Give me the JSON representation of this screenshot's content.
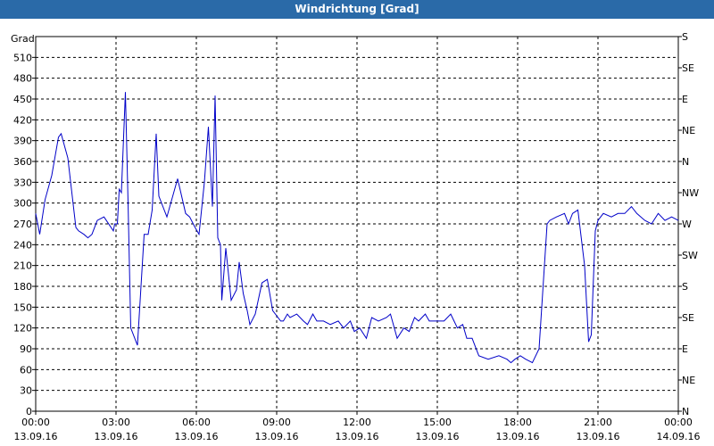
{
  "window": {
    "title": "Windrichtung [Grad]"
  },
  "chart_data": {
    "type": "line",
    "title": "Windrichtung [Grad]",
    "ylabel": "Grad",
    "ylim": [
      0,
      540
    ],
    "yticks": [
      0,
      30,
      60,
      90,
      120,
      150,
      180,
      210,
      240,
      270,
      300,
      330,
      360,
      390,
      420,
      450,
      480,
      510
    ],
    "right_axis_labels": [
      "N",
      "NE",
      "E",
      "SE",
      "S",
      "SW",
      "W",
      "NW",
      "N",
      "NE",
      "E",
      "SE",
      "S"
    ],
    "right_axis_values": [
      0,
      45,
      90,
      135,
      180,
      225,
      270,
      315,
      360,
      405,
      450,
      495,
      540
    ],
    "xlim": [
      0,
      24
    ],
    "xticks": [
      {
        "hour": 0,
        "time": "00:00",
        "date": "13.09.16"
      },
      {
        "hour": 3,
        "time": "03:00",
        "date": "13.09.16"
      },
      {
        "hour": 6,
        "time": "06:00",
        "date": "13.09.16"
      },
      {
        "hour": 9,
        "time": "09:00",
        "date": "13.09.16"
      },
      {
        "hour": 12,
        "time": "12:00",
        "date": "13.09.16"
      },
      {
        "hour": 15,
        "time": "15:00",
        "date": "13.09.16"
      },
      {
        "hour": 18,
        "time": "18:00",
        "date": "13.09.16"
      },
      {
        "hour": 21,
        "time": "21:00",
        "date": "13.09.16"
      },
      {
        "hour": 24,
        "time": "00:00",
        "date": "14.09.16"
      }
    ],
    "grid": true,
    "line_color": "#0000c8",
    "series": [
      {
        "x": [
          0,
          0.15,
          0.35,
          0.6,
          0.85,
          0.95,
          1.2,
          1.5,
          1.6,
          1.8,
          1.95,
          2.1,
          2.3,
          2.55,
          2.9,
          2.95,
          3.05,
          3.12,
          3.2,
          3.35,
          3.45,
          3.55,
          3.8,
          4.05,
          4.2,
          4.35,
          4.5,
          4.6,
          4.9,
          5.3,
          5.6,
          5.75,
          5.95,
          6.1,
          6.3,
          6.45,
          6.6,
          6.7,
          6.8,
          6.9,
          6.95,
          7.1,
          7.3,
          7.5,
          7.6,
          7.75,
          7.9,
          8.0,
          8.2,
          8.45,
          8.65,
          8.85,
          9.15,
          9.25,
          9.4,
          9.5,
          9.75,
          10.0,
          10.15,
          10.35,
          10.5,
          10.75,
          11.0,
          11.3,
          11.5,
          11.75,
          11.9,
          12.1,
          12.35,
          12.55,
          12.8,
          13.1,
          13.25,
          13.5,
          13.75,
          13.95,
          14.15,
          14.3,
          14.55,
          14.7,
          15.0,
          15.25,
          15.5,
          15.75,
          15.95,
          16.1,
          16.3,
          16.55,
          16.9,
          17.3,
          17.6,
          17.75,
          17.9,
          18.1,
          18.3,
          18.55,
          18.8,
          19.1,
          19.2,
          19.45,
          19.75,
          19.9,
          20.05,
          20.25,
          20.5,
          20.65,
          20.75,
          20.9,
          21.0,
          21.2,
          21.5,
          21.75,
          22.0,
          22.25,
          22.45,
          22.75,
          23.0,
          23.25,
          23.5,
          23.75,
          24.0
        ],
        "y": [
          285,
          255,
          305,
          340,
          395,
          400,
          365,
          265,
          260,
          255,
          250,
          255,
          275,
          280,
          260,
          270,
          270,
          320,
          315,
          460,
          300,
          120,
          95,
          255,
          255,
          290,
          400,
          310,
          280,
          335,
          285,
          280,
          265,
          255,
          330,
          410,
          295,
          455,
          250,
          240,
          160,
          235,
          160,
          175,
          215,
          170,
          145,
          125,
          140,
          185,
          190,
          145,
          130,
          130,
          140,
          135,
          140,
          130,
          125,
          140,
          130,
          130,
          125,
          130,
          120,
          130,
          115,
          120,
          105,
          135,
          130,
          135,
          140,
          105,
          120,
          115,
          135,
          130,
          140,
          130,
          130,
          130,
          140,
          120,
          125,
          105,
          105,
          80,
          75,
          80,
          75,
          70,
          75,
          80,
          75,
          70,
          90,
          270,
          275,
          280,
          285,
          270,
          285,
          290,
          210,
          100,
          110,
          260,
          275,
          285,
          280,
          285,
          285,
          295,
          285,
          275,
          270,
          285,
          275,
          280,
          275
        ]
      }
    ]
  }
}
